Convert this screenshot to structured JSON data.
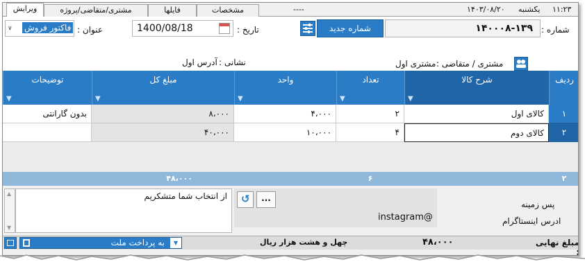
{
  "tabs": {
    "edit": "ویرایش",
    "customer_project": "مشتری/متقاضی/پروژه",
    "files": "فایلها",
    "specs": "مشخصات",
    "dashes": "----",
    "date": "۱۴۰۳/۰۸/۲۰",
    "weekday": "یکشنبه",
    "time": "۱۱:۲۳"
  },
  "form": {
    "number_label": "شماره :",
    "number_value": "۱۴۰۰۰۸-۱۳۹",
    "new_number_button": "شماره جدید",
    "date_label": "تاریخ :",
    "date_value": "1400/08/18",
    "title_label": "عنوان :",
    "title_value": "فاکتور فروش",
    "customer_label": "مشتری / متقاضی :",
    "customer_value": "مشتری اول",
    "address_label": "نشانی :",
    "address_value": "آدرس اول"
  },
  "grid": {
    "headers": {
      "row": "ردیف",
      "description": "شرح کالا",
      "quantity": "تعداد",
      "unit": "واحد",
      "total": "مبلغ کل",
      "notes": "توضیحات"
    },
    "rows": [
      {
        "num": "۱",
        "description": "کالای اول",
        "quantity": "۲",
        "unit": "۴،۰۰۰",
        "total": "۸،۰۰۰",
        "notes": "بدون گارانتی"
      },
      {
        "num": "۲",
        "description": "کالای دوم",
        "quantity": "۴",
        "unit": "۱۰،۰۰۰",
        "total": "۴۰،۰۰۰",
        "notes": ""
      }
    ],
    "footer": {
      "rows": "۲",
      "quantity": "۶",
      "total": "۴۸،۰۰۰"
    }
  },
  "notes": {
    "text": "از انتخاب شما متشکریم",
    "background_label": "پس زمینه",
    "instagram_label": "ادرس اینستاگرام",
    "instagram_value": "instagram@",
    "more_button": "..."
  },
  "bottom": {
    "final_amount_label": "مبلغ نهایی :",
    "final_amount_value": "۴۸،۰۰۰",
    "amount_in_words": "چهل و هشت هزار  ریال",
    "payment_option": "به پرداخت ملت"
  },
  "colors": {
    "accent": "#2a7cc7",
    "header_dark": "#1f65a7",
    "footer": "#8fb8db"
  }
}
